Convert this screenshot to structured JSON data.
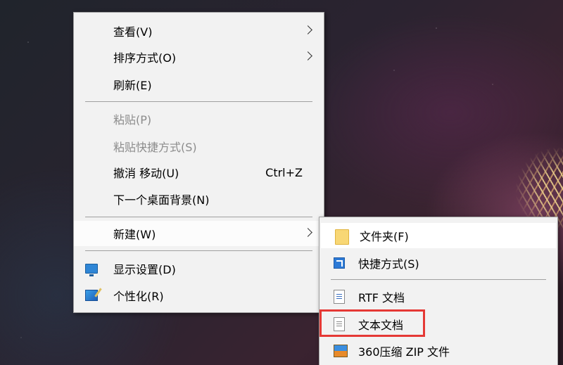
{
  "context_menu": {
    "items": [
      {
        "label": "查看(V)",
        "has_submenu": true
      },
      {
        "label": "排序方式(O)",
        "has_submenu": true
      },
      {
        "label": "刷新(E)"
      },
      {
        "label": "粘贴(P)",
        "disabled": true
      },
      {
        "label": "粘贴快捷方式(S)",
        "disabled": true
      },
      {
        "label": "撤消 移动(U)",
        "shortcut": "Ctrl+Z"
      },
      {
        "label": "下一个桌面背景(N)"
      },
      {
        "label": "新建(W)",
        "has_submenu": true,
        "highlighted": true
      },
      {
        "label": "显示设置(D)",
        "icon": "display-icon"
      },
      {
        "label": "个性化(R)",
        "icon": "personalize-icon"
      }
    ]
  },
  "new_submenu": {
    "items": [
      {
        "label": "文件夹(F)",
        "icon": "folder-icon"
      },
      {
        "label": "快捷方式(S)",
        "icon": "shortcut-icon"
      },
      {
        "label": "RTF 文档",
        "icon": "rtf-document-icon"
      },
      {
        "label": "文本文档",
        "icon": "text-document-icon",
        "annotated": true
      },
      {
        "label": "360压缩 ZIP 文件",
        "icon": "zip-archive-icon"
      }
    ]
  },
  "annotation": {
    "color": "#e53935"
  },
  "colors": {
    "menu_background": "#f2f2f2",
    "disabled_text": "#8c8c8c",
    "separator": "#a0a0a0"
  }
}
